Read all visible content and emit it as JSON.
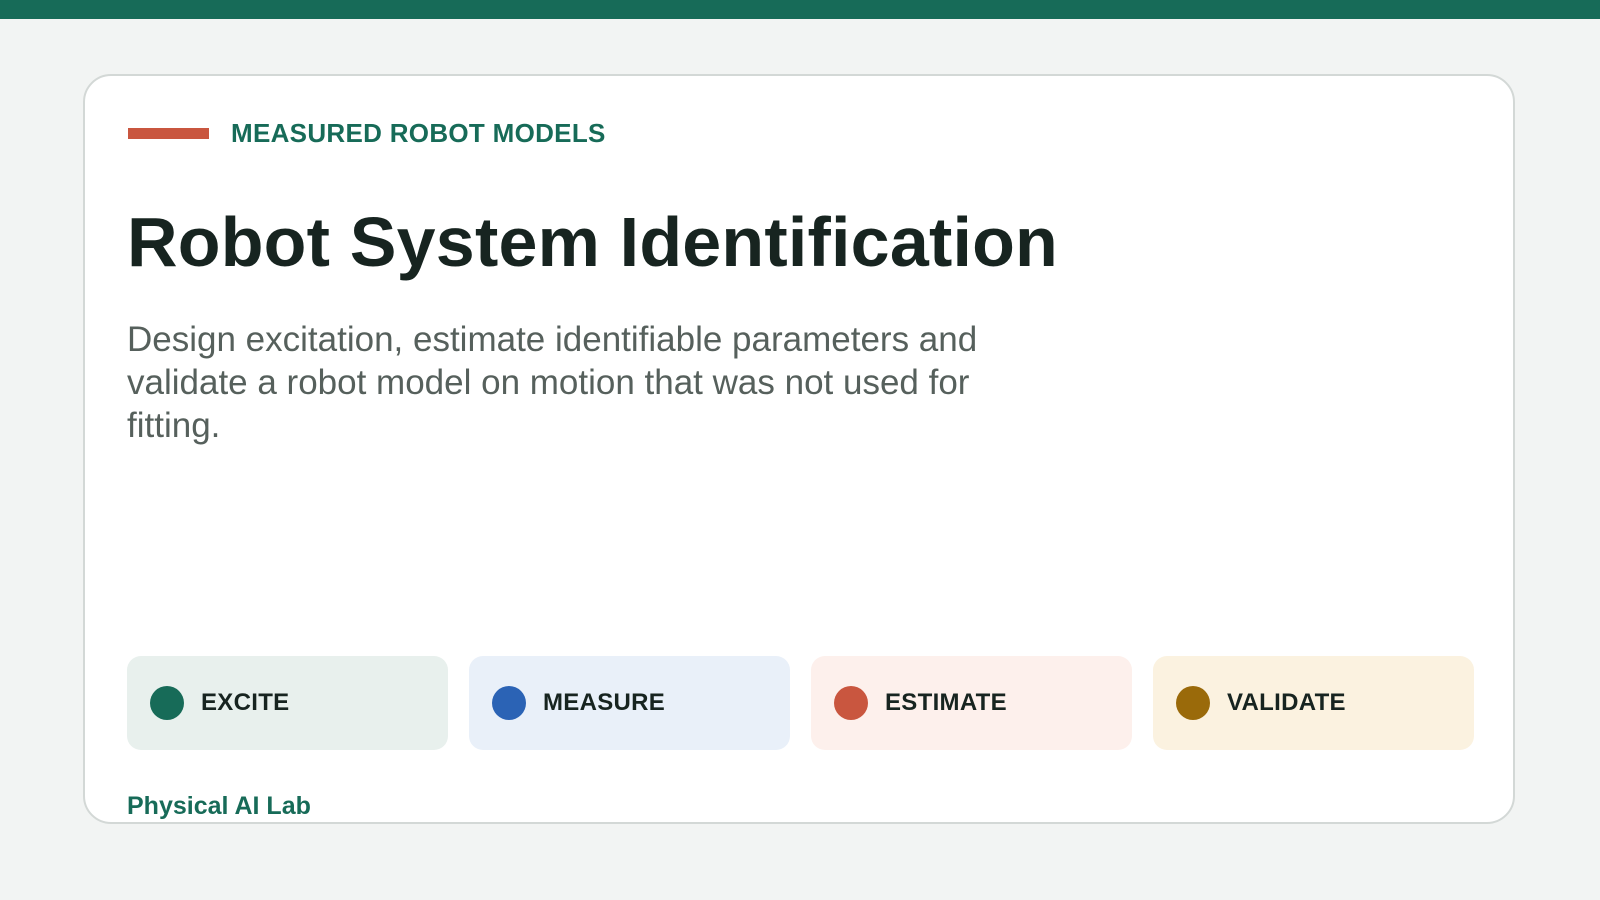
{
  "header": {
    "eyebrow": "MEASURED ROBOT MODELS",
    "title": "Robot System Identification",
    "subtitle": "Design excitation, estimate identifiable parameters and validate a robot model on motion that was not used for fitting."
  },
  "steps": [
    {
      "label": "EXCITE",
      "dot_color": "#176b58",
      "bg_color": "#e8f0ed"
    },
    {
      "label": "MEASURE",
      "dot_color": "#2b63b5",
      "bg_color": "#e9f0f9"
    },
    {
      "label": "ESTIMATE",
      "dot_color": "#c9563f",
      "bg_color": "#fdf0ec"
    },
    {
      "label": "VALIDATE",
      "dot_color": "#9a6a0a",
      "bg_color": "#fbf2e0"
    }
  ],
  "footer": {
    "lab_name": "Physical AI Lab"
  },
  "colors": {
    "brand": "#176b58",
    "accent": "#c9563f",
    "title": "#172420",
    "muted": "#56605c",
    "page_bg": "#f2f4f3"
  }
}
